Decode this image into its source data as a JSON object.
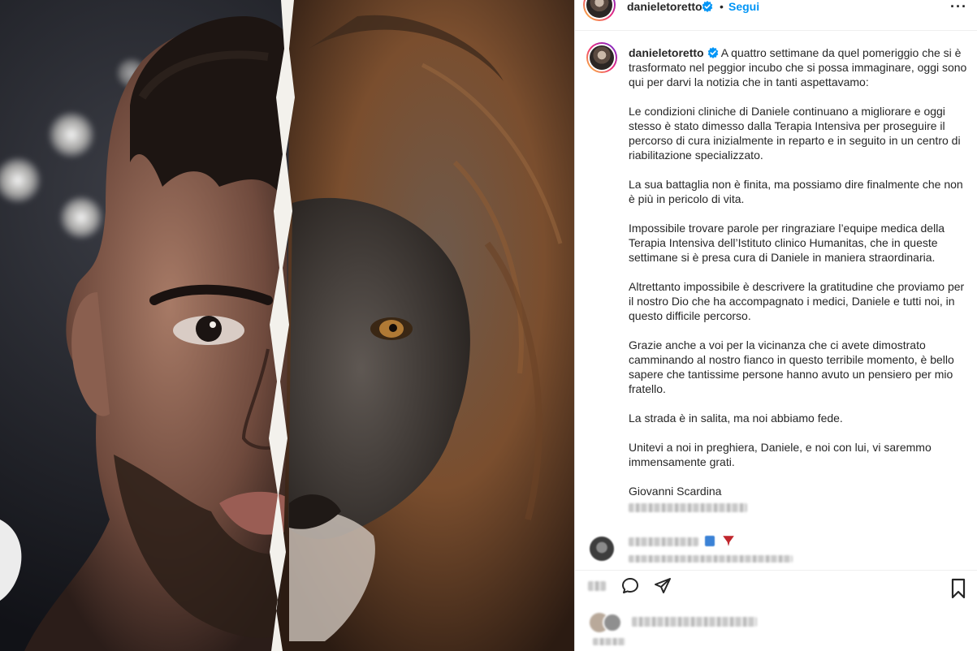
{
  "post": {
    "username": "danieletoretto",
    "separator": "•",
    "follow_label": "Segui",
    "more_label": "···"
  },
  "caption": {
    "username": "danieletoretto",
    "paragraphs": [
      "A quattro settimane da quel pomeriggio che si è trasformato nel peggior incubo che si possa immaginare, oggi sono qui per darvi la notizia che in tanti aspettavamo:",
      "Le condizioni cliniche di Daniele continuano a migliorare e oggi stesso è stato dimesso dalla Terapia Intensiva per proseguire il percorso di cura inizialmente in reparto e in seguito in un centro di riabilitazione specializzato.",
      "La sua battaglia non è finita, ma possiamo dire finalmente che non è più in pericolo di vita.",
      "Impossibile trovare parole per ringraziare l’equipe medica della Terapia Intensiva dell’Istituto clinico Humanitas, che in queste settimane si è presa cura di Daniele in maniera straordinaria.",
      "Altrettanto impossibile è descrivere la gratitudine che proviamo per il nostro Dio che ha accompagnato i medici, Daniele e tutti noi, in questo difficile percorso.",
      "Grazie anche a voi per la vicinanza che ci avete dimostrato camminando al nostro fianco in questo terribile momento, è bello sapere che tantissime persone hanno avuto un pensiero per mio fratello.",
      "La strada è in salita, ma noi abbiamo fede.",
      "Unitevi a noi in preghiera, Daniele, e noi con lui, vi saremmo immensamente grati.",
      "Giovanni Scardina"
    ]
  },
  "colors": {
    "accent": "#0095f6",
    "verified": "#0095f6",
    "text": "#262626",
    "muted": "#8e8e8e"
  },
  "icons": {
    "verified": "verified-badge-icon",
    "comment": "comment-bubble-icon",
    "share": "send-arrow-icon",
    "save": "bookmark-icon",
    "more": "more-options-icon"
  }
}
